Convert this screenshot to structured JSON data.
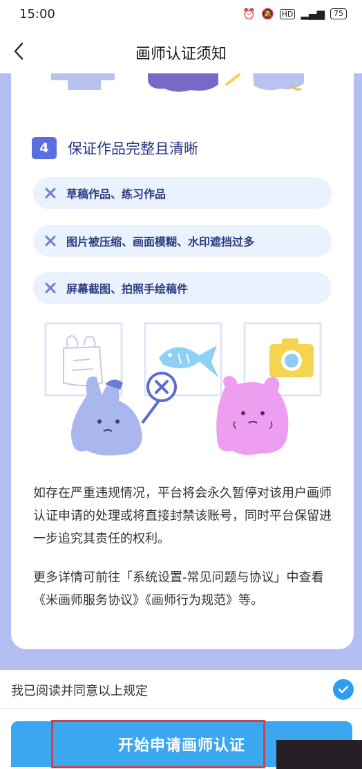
{
  "status_bar": {
    "time": "15:00",
    "icons": [
      "alarm-icon",
      "mute-icon",
      "hd-icon",
      "signal-icon"
    ],
    "battery": "75"
  },
  "nav": {
    "title": "画师认证须知"
  },
  "step": {
    "number": "4",
    "title": "保证作品完整且清晰"
  },
  "rules": [
    {
      "text": "草稿作品、练习作品"
    },
    {
      "text": "图片被压缩、画面模糊、水印遮挡过多"
    },
    {
      "text": "屏幕截图、拍照手绘稿件"
    }
  ],
  "notice": {
    "paragraph1": "如存在严重违规情况，平台将会永久暂停对该用户画师认证申请的处理或将直接封禁该账号，同时平台保留进一步追究其责任的权利。",
    "paragraph2": "更多详情可前往「系统设置-常见问题与协议」中查看《米画师服务协议》《画师行为规范》等。"
  },
  "agreement": {
    "label": "我已阅读并同意以上规定",
    "checked": true
  },
  "action": {
    "start_label": "开始申请画师认证"
  },
  "colors": {
    "accent": "#3aa7ef",
    "badge": "#5a6ee0",
    "panel": "#b3bef2",
    "rule_bg": "#e9f2fd"
  }
}
